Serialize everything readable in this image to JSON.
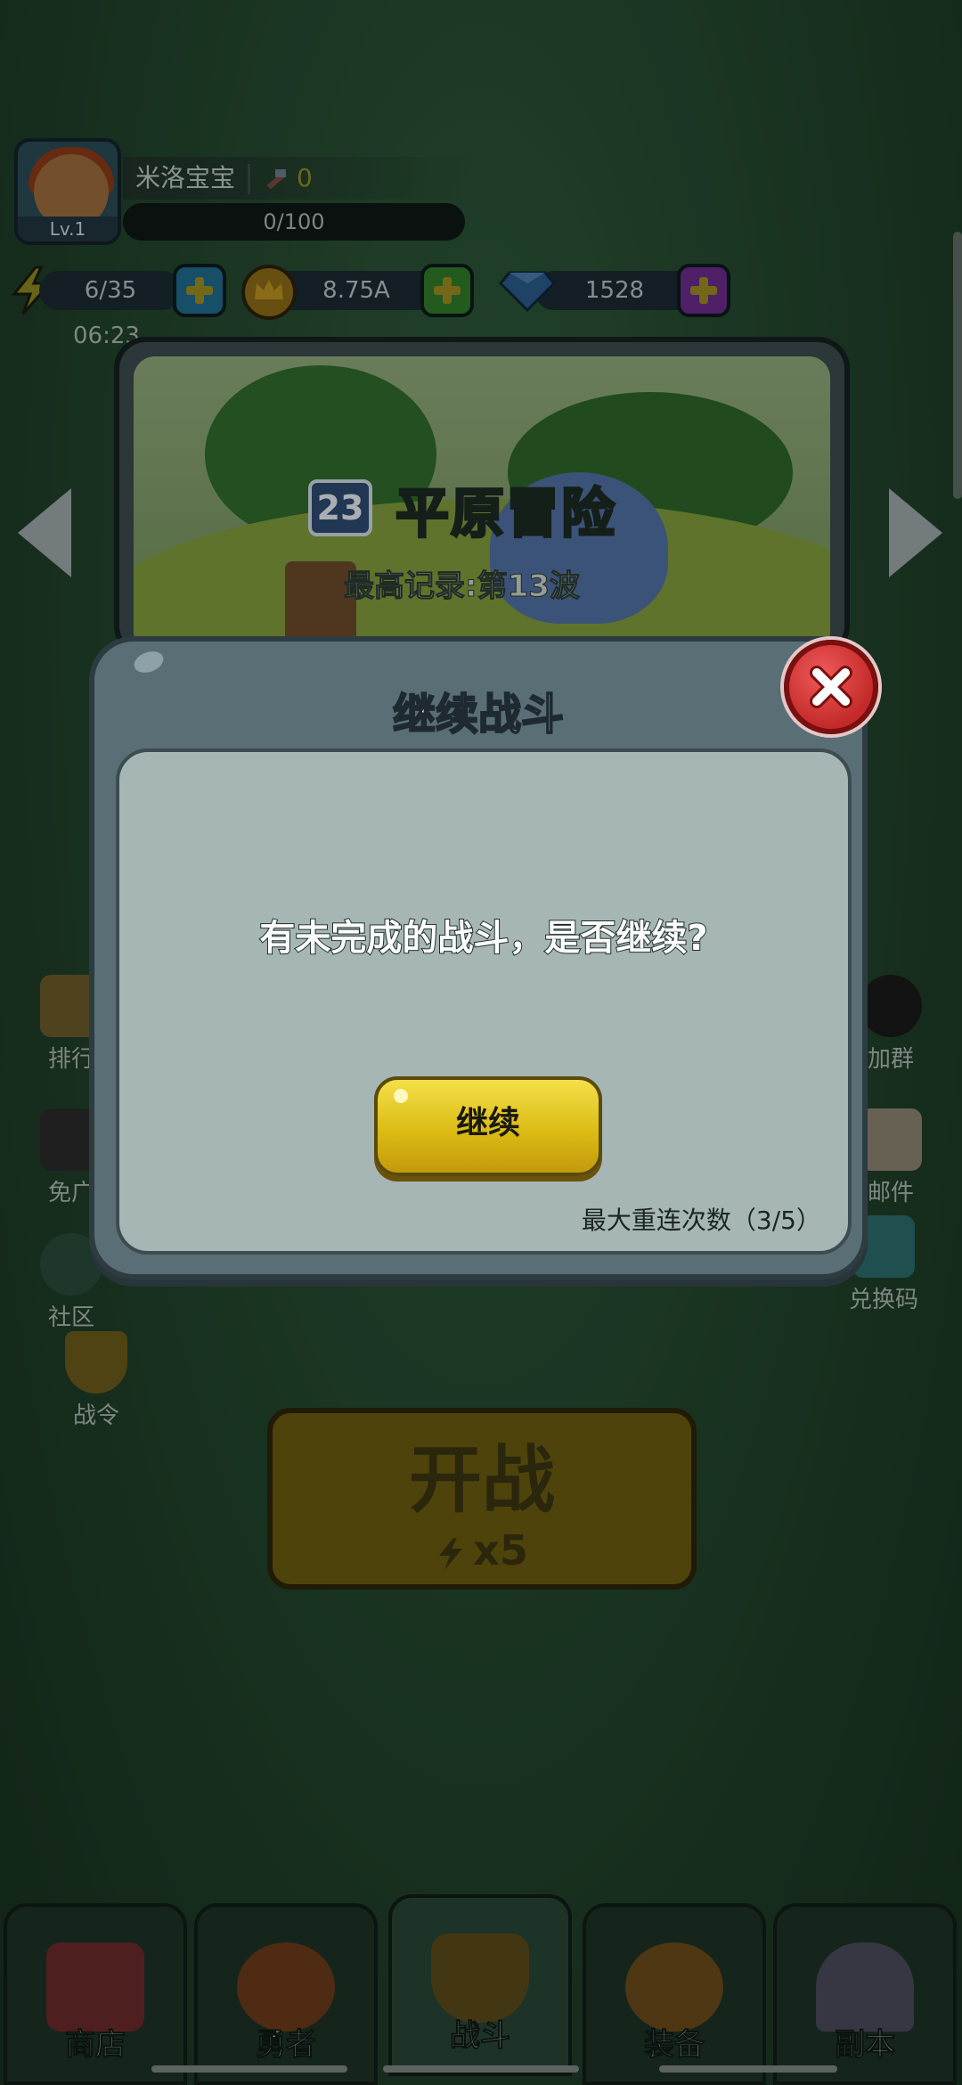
{
  "player": {
    "name": "米洛宝宝",
    "level": "Lv.1",
    "power": "0",
    "xp": "0/100"
  },
  "resources": {
    "energy": "6/35",
    "gold": "8.75A",
    "gems": "1528",
    "energy_timer": "06:23"
  },
  "stage": {
    "number": "23",
    "title": "平原冒险",
    "record": "最高记录:第13波"
  },
  "side_buttons": {
    "left": [
      {
        "label": "排行",
        "icon": "banner-icon"
      },
      {
        "label": "免广",
        "icon": "dice-icon"
      },
      {
        "label": "社区",
        "icon": "taptap-icon"
      },
      {
        "label": "战令",
        "icon": "shield-sword-icon"
      }
    ],
    "right": [
      {
        "label": "加群",
        "icon": "penguin-icon"
      },
      {
        "label": "邮件",
        "icon": "mail-icon"
      },
      {
        "label": "兑换码",
        "icon": "ticket-icon"
      }
    ]
  },
  "start_battle": {
    "label": "开战",
    "cost": "x5"
  },
  "nav": {
    "tabs": [
      {
        "label": "商店",
        "icon": "shop-icon"
      },
      {
        "label": "勇者",
        "icon": "hero-icon"
      },
      {
        "label": "战斗",
        "icon": "crossed-swords-icon"
      },
      {
        "label": "装备",
        "icon": "armor-icon"
      },
      {
        "label": "副本",
        "icon": "portal-icon"
      }
    ],
    "active_index": 2
  },
  "dialog": {
    "title": "继续战斗",
    "message": "有未完成的战斗，是否继续?",
    "continue_label": "继续",
    "retry_note": "最大重连次数（3/5）"
  },
  "colors": {
    "accent_yellow": "#e6c61a",
    "close_red": "#d83a3a",
    "dialog_frame": "#5a6e76",
    "dialog_body": "#a5b6b4"
  }
}
